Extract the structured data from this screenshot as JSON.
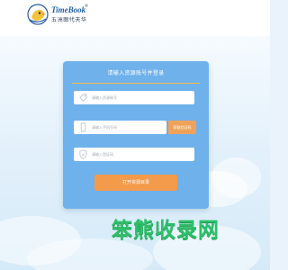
{
  "brand": {
    "title": "TimeBook",
    "subtitle": "五洲图代天华",
    "reg_mark": "®"
  },
  "login": {
    "title": "请输入资源账号并登录",
    "account_placeholder": "请输入资源账号",
    "phone_placeholder": "请输入手机号码",
    "sms_button_label": "获取验证码",
    "code_placeholder": "请输入验证码",
    "submit_label": "打开资源目录"
  },
  "icons": {
    "logo": "duck-mascot-icon",
    "account": "tag-icon",
    "phone": "phone-icon",
    "code": "shield-icon"
  },
  "watermark": {
    "text": "笨熊收录网"
  },
  "colors": {
    "card": "#6fb1eb",
    "accent_line": "#f2c04a",
    "button": "#f39a4b",
    "brand_blue": "#1f5fae",
    "watermark": "#2fbf6a"
  }
}
